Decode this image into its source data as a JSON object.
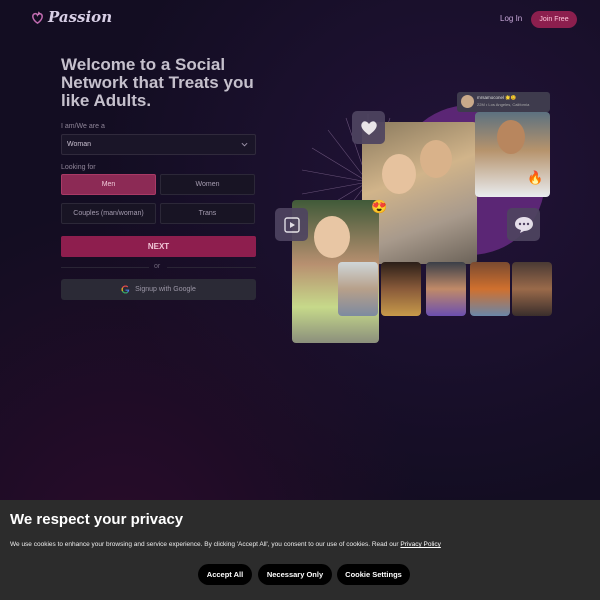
{
  "header": {
    "brand": "Passion",
    "login_label": "Log In",
    "join_label": "Join Free"
  },
  "signup": {
    "headline": "Welcome to a Social Network that Treats you like Adults.",
    "iam_label": "I am/We are a",
    "iam_selected": "Woman",
    "looking_label": "Looking for",
    "options": [
      "Men",
      "Women",
      "Couples (man/woman)",
      "Trans"
    ],
    "selected_option": "Men",
    "next_label": "NEXT",
    "or_label": "or",
    "google_label": "Signup with Google"
  },
  "collage": {
    "profile_name": "mrsamoconel 🌟😊",
    "profile_sub": "22M • Los Angeles, California",
    "icons": [
      "heart-icon",
      "video-icon",
      "chat-bubble-icon",
      "heart-eyes-emoji",
      "fire-emoji"
    ]
  },
  "cookie": {
    "title": "We respect your privacy",
    "text": "We use cookies to enhance your browsing and service experience. By clicking 'Accept All', you consent to our use of cookies. Read our ",
    "policy_link": "Privacy Policy",
    "accept_all": "Accept All",
    "necessary_only": "Necessary Only",
    "settings": "Cookie Settings"
  },
  "colors": {
    "accent": "#8e1e4e",
    "background": "#130d22",
    "cookie_bg": "#2c2c2c"
  }
}
